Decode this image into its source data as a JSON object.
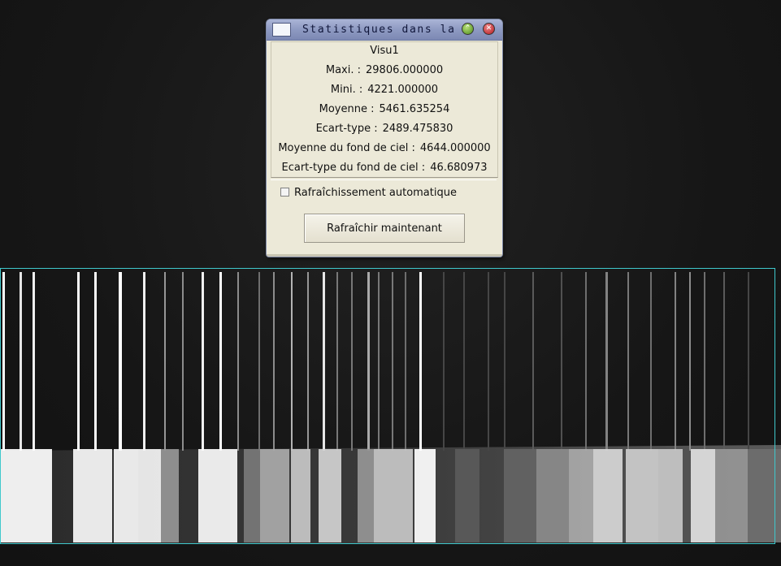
{
  "window": {
    "title": "Statistiques dans la",
    "visu": "Visu1",
    "stats": [
      {
        "label": "Maxi. :",
        "value": "29806.000000"
      },
      {
        "label": "Mini. :",
        "value": "4221.000000"
      },
      {
        "label": "Moyenne :",
        "value": "5461.635254"
      },
      {
        "label": "Ecart-type :",
        "value": "2489.475830"
      },
      {
        "label": "Moyenne du fond de ciel :",
        "value": "4644.000000"
      },
      {
        "label": "Ecart-type du fond de ciel :",
        "value": "46.680973"
      }
    ],
    "auto_refresh_label": "Rafraîchissement automatique",
    "auto_refresh_checked": false,
    "refresh_button_label": "Rafraîchir maintenant"
  },
  "colors": {
    "selection_box": "#3fc8cc",
    "titlebar": "#8e9ac2",
    "panel": "#ece9d8"
  },
  "icons": {
    "window_icon": "window-menu-icon",
    "minimize": "minimize-icon",
    "close": "close-icon"
  }
}
